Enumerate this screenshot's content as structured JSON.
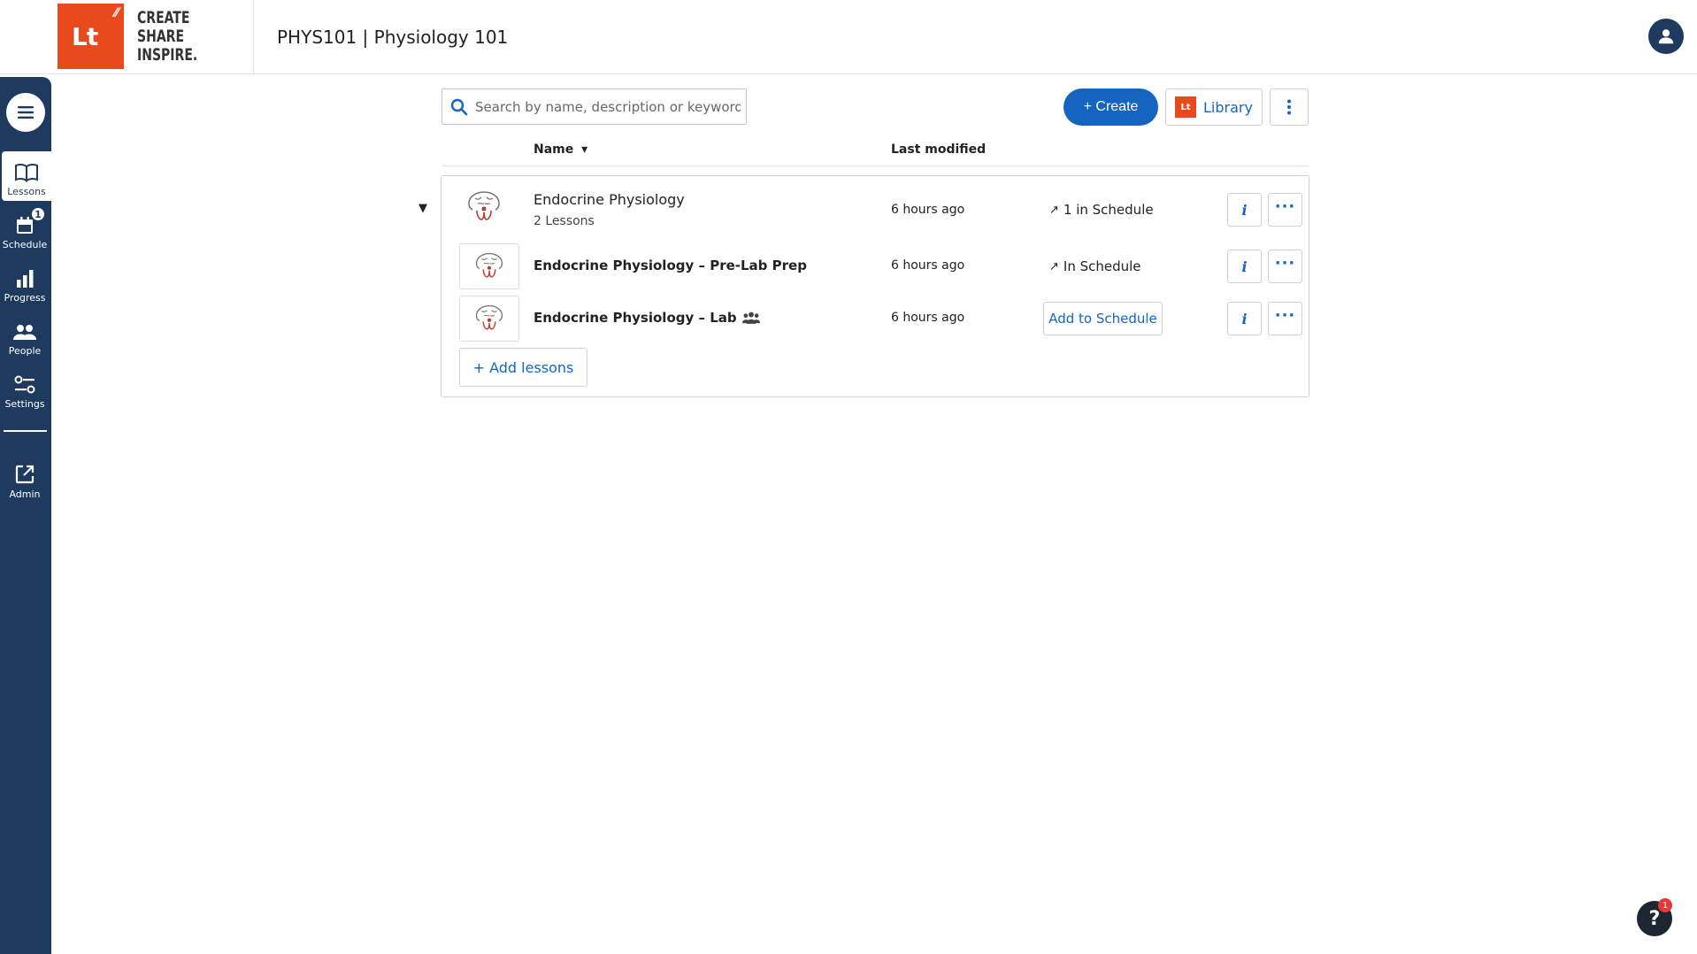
{
  "header": {
    "logo_mark": "Lt",
    "logo_words": [
      "CREATE",
      "SHARE",
      "INSPIRE."
    ],
    "course_title": "PHYS101 | Physiology 101"
  },
  "sidebar": {
    "items": [
      {
        "label": "Lessons",
        "icon": "book-icon",
        "active": true
      },
      {
        "label": "Schedule",
        "icon": "calendar-icon",
        "badge": "1"
      },
      {
        "label": "Progress",
        "icon": "bar-chart-icon"
      },
      {
        "label": "People",
        "icon": "people-icon"
      },
      {
        "label": "Settings",
        "icon": "sliders-icon"
      },
      {
        "label": "Admin",
        "icon": "external-link-icon"
      }
    ]
  },
  "toolbar": {
    "search_placeholder": "Search by name, description or keyword",
    "create_label": "+ Create",
    "library_label": "Library",
    "library_logo": "Lt"
  },
  "table": {
    "col_name": "Name",
    "col_name_sort": "▾",
    "col_modified": "Last modified"
  },
  "folder": {
    "collapse_glyph": "▼",
    "title": "Endocrine Physiology",
    "subtitle": "2 Lessons",
    "modified": "6 hours ago",
    "schedule_status": "1 in Schedule",
    "lessons": [
      {
        "title": "Endocrine Physiology – Pre-Lab Prep",
        "modified": "6 hours ago",
        "schedule_status": "In Schedule"
      },
      {
        "title": "Endocrine Physiology – Lab",
        "modified": "6 hours ago",
        "schedule_action": "Add to Schedule"
      }
    ],
    "add_lessons_label": "+ Add lessons"
  },
  "help": {
    "label": "?",
    "badge": "1"
  },
  "colors": {
    "sidebar": "#1f3a5f",
    "accent": "#1565c0",
    "brand": "#e8491d"
  }
}
